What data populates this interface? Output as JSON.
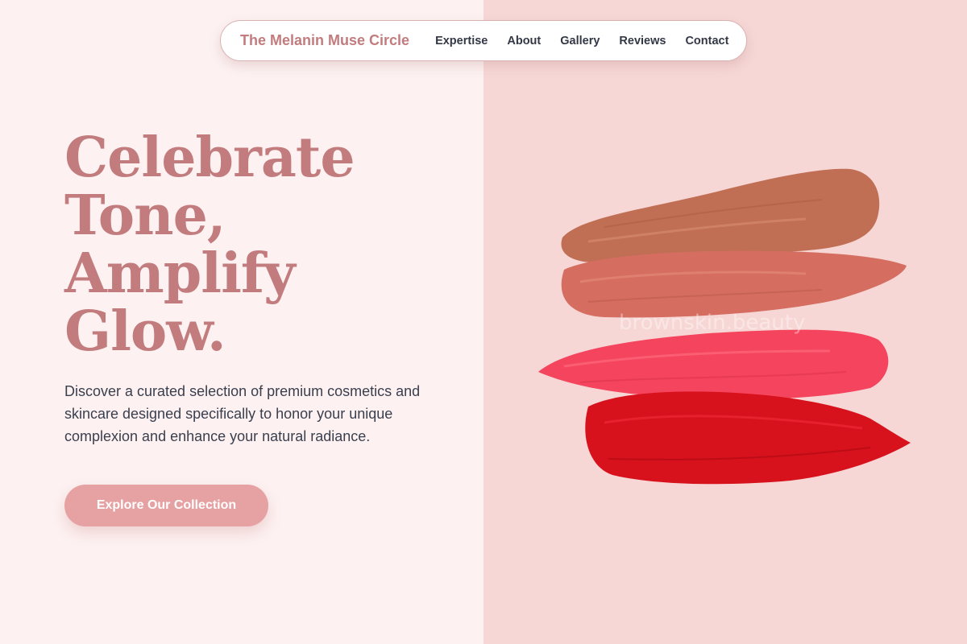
{
  "nav": {
    "brand": "The Melanin Muse Circle",
    "links": [
      "Expertise",
      "About",
      "Gallery",
      "Reviews",
      "Contact"
    ]
  },
  "hero": {
    "title_lines": [
      "Celebrate",
      "Tone,",
      "Amplify",
      "Glow."
    ],
    "description": "Discover a curated selection of premium cosmetics and skincare designed specifically to honor your unique complexion and enhance your natural radiance.",
    "cta_label": "Explore Our Collection"
  },
  "image": {
    "watermark": "brownskin.beauty",
    "swatch_colors": [
      "#c06f55",
      "#d56e61",
      "#f5445e",
      "#d8121d"
    ]
  },
  "colors": {
    "accent": "#c27c7e",
    "button": "#e6a1a3",
    "left_bg": "#fdf1f1",
    "right_bg": "#f6d7d5",
    "text": "#3a3f4e"
  }
}
